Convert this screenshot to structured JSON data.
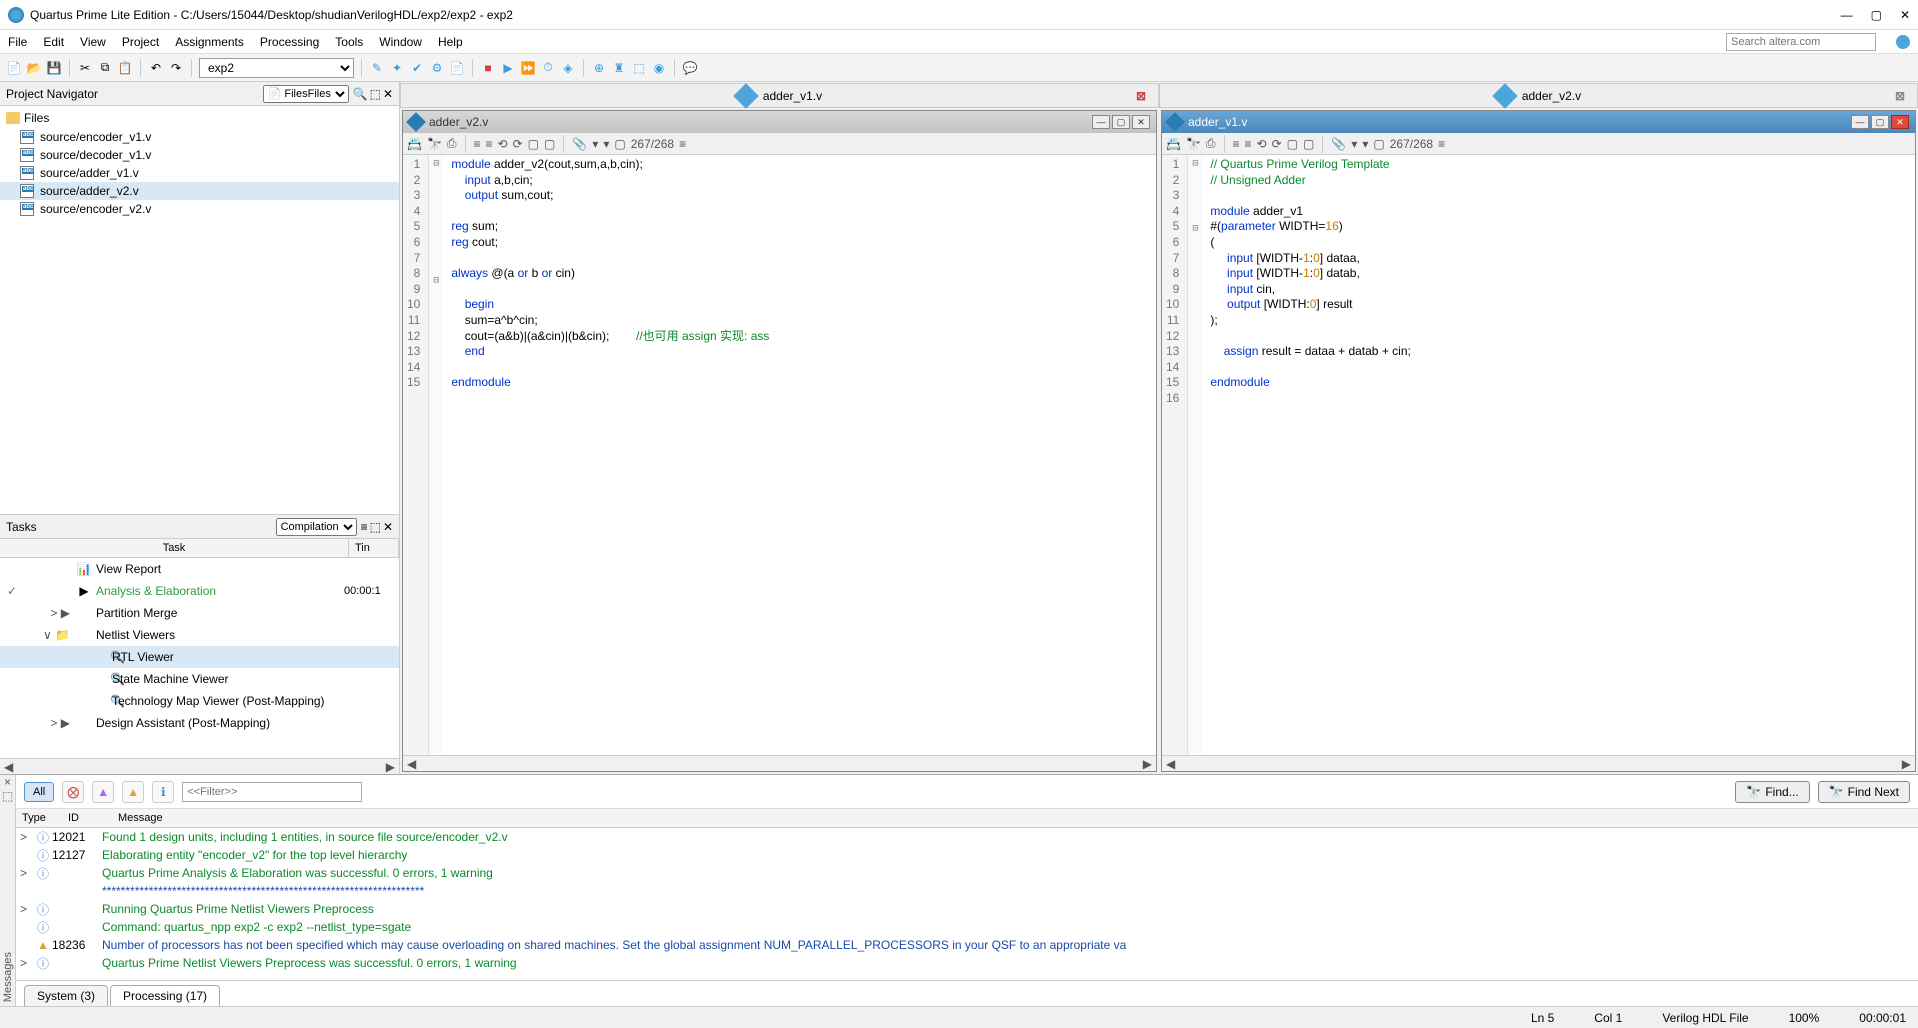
{
  "window": {
    "title": "Quartus Prime Lite Edition - C:/Users/15044/Desktop/shudianVerilogHDL/exp2/exp2 - exp2",
    "search_placeholder": "Search altera.com"
  },
  "menu": [
    "File",
    "Edit",
    "View",
    "Project",
    "Assignments",
    "Processing",
    "Tools",
    "Window",
    "Help"
  ],
  "toolbar_project": "exp2",
  "navigator": {
    "title": "Project Navigator",
    "filter": "Files",
    "root": "Files",
    "files": [
      "source/encoder_v1.v",
      "source/decoder_v1.v",
      "source/adder_v1.v",
      "source/adder_v2.v",
      "source/encoder_v2.v"
    ],
    "selected_index": 3
  },
  "tasks": {
    "title": "Tasks",
    "filter": "Compilation",
    "columns": [
      "Task",
      "Tin"
    ],
    "rows": [
      {
        "tree": "",
        "icon": "📊",
        "label": "View Report",
        "time": "",
        "status": ""
      },
      {
        "tree": "",
        "icon": "▶",
        "label": "Analysis & Elaboration",
        "time": "00:00:1",
        "status": "✓",
        "green": true
      },
      {
        "tree": "> ▶",
        "icon": "",
        "label": "Partition Merge",
        "time": "",
        "status": ""
      },
      {
        "tree": "∨ 📁",
        "icon": "",
        "label": "Netlist Viewers",
        "time": "",
        "status": ""
      },
      {
        "tree": "",
        "icon": "🔍",
        "label": "RTL Viewer",
        "time": "",
        "status": "",
        "selected": true,
        "indent": 2
      },
      {
        "tree": "",
        "icon": "🔍",
        "label": "State Machine Viewer",
        "time": "",
        "status": "",
        "indent": 2
      },
      {
        "tree": "",
        "icon": "🔍",
        "label": "Technology Map Viewer (Post-Mapping)",
        "time": "",
        "status": "",
        "indent": 2
      },
      {
        "tree": "> ▶",
        "icon": "",
        "label": "Design Assistant (Post-Mapping)",
        "time": "",
        "status": ""
      }
    ]
  },
  "tabs": [
    {
      "label": "adder_v1.v",
      "close_color": "red"
    },
    {
      "label": "adder_v2.v",
      "close_color": "gray"
    }
  ],
  "editor_left": {
    "title": "adder_v2.v",
    "active": false,
    "lines": [
      {
        "n": 1,
        "html": "<span class='kw'>module</span> adder_v2(cout,sum,a,b,cin);"
      },
      {
        "n": 2,
        "html": "    <span class='kw'>input</span> a,b,cin;"
      },
      {
        "n": 3,
        "html": "    <span class='kw'>output</span> sum,cout;"
      },
      {
        "n": 4,
        "html": ""
      },
      {
        "n": 5,
        "html": "<span class='kw'>reg</span> sum;"
      },
      {
        "n": 6,
        "html": "<span class='kw'>reg</span> cout;"
      },
      {
        "n": 7,
        "html": ""
      },
      {
        "n": 8,
        "html": "<span class='kw'>always</span> @(a <span class='kw'>or</span> b <span class='kw'>or</span> cin)"
      },
      {
        "n": 9,
        "html": ""
      },
      {
        "n": 10,
        "html": "    <span class='kw'>begin</span>"
      },
      {
        "n": 11,
        "html": "    sum=a^b^cin;"
      },
      {
        "n": 12,
        "html": "    cout=(a&b)|(a&cin)|(b&cin);        <span class='cm'>//也可用 assign 实现: ass</span>"
      },
      {
        "n": 13,
        "html": "    <span class='kw'>end</span>"
      },
      {
        "n": 14,
        "html": ""
      },
      {
        "n": 15,
        "html": "<span class='kw'>endmodule</span>"
      }
    ]
  },
  "editor_right": {
    "title": "adder_v1.v",
    "active": true,
    "lines": [
      {
        "n": 1,
        "html": "<span class='cm'>// Quartus Prime Verilog Template</span>"
      },
      {
        "n": 2,
        "html": "<span class='cm'>// Unsigned Adder</span>"
      },
      {
        "n": 3,
        "html": ""
      },
      {
        "n": 4,
        "html": "<span class='kw'>module</span> adder_v1"
      },
      {
        "n": 5,
        "html": "#(<span class='kw'>parameter</span> WIDTH=<span class='num'>16</span>)"
      },
      {
        "n": 6,
        "html": "("
      },
      {
        "n": 7,
        "html": "     <span class='kw'>input</span> [WIDTH-<span class='num'>1</span>:<span class='num'>0</span>] dataa,"
      },
      {
        "n": 8,
        "html": "     <span class='kw'>input</span> [WIDTH-<span class='num'>1</span>:<span class='num'>0</span>] datab,"
      },
      {
        "n": 9,
        "html": "     <span class='kw'>input</span> cin,"
      },
      {
        "n": 10,
        "html": "     <span class='kw'>output</span> [WIDTH:<span class='num'>0</span>] result"
      },
      {
        "n": 11,
        "html": ");"
      },
      {
        "n": 12,
        "html": ""
      },
      {
        "n": 13,
        "html": "    <span class='kw'>assign</span> result = dataa + datab + cin;"
      },
      {
        "n": 14,
        "html": ""
      },
      {
        "n": 15,
        "html": "<span class='kw'>endmodule</span>"
      },
      {
        "n": 16,
        "html": ""
      }
    ]
  },
  "messages": {
    "toolbar": {
      "all_label": "All",
      "filter_placeholder": "<<Filter>>",
      "find_label": "Find...",
      "find_next_label": "Find Next"
    },
    "head": [
      "Type",
      "ID",
      "Message"
    ],
    "rows": [
      {
        "toggle": ">",
        "sev": "info",
        "id": "12021",
        "text": "Found 1 design units, including 1 entities, in source file source/encoder_v2.v",
        "cls": "green"
      },
      {
        "toggle": "",
        "sev": "info",
        "id": "12127",
        "text": "Elaborating entity \"encoder_v2\" for the top level hierarchy",
        "cls": "green"
      },
      {
        "toggle": ">",
        "sev": "info",
        "id": "",
        "text": "Quartus Prime Analysis & Elaboration was successful. 0 errors, 1 warning",
        "cls": "green"
      },
      {
        "toggle": "",
        "sev": "",
        "id": "",
        "text": "*********************************************************************",
        "cls": "blue"
      },
      {
        "toggle": ">",
        "sev": "info",
        "id": "",
        "text": "Running Quartus Prime Netlist Viewers Preprocess",
        "cls": "green"
      },
      {
        "toggle": "",
        "sev": "info",
        "id": "",
        "text": "Command: quartus_npp exp2 -c exp2 --netlist_type=sgate",
        "cls": "green"
      },
      {
        "toggle": "",
        "sev": "warn",
        "id": "18236",
        "text": "Number of processors has not been specified which may cause overloading on shared machines.  Set the global assignment NUM_PARALLEL_PROCESSORS in your QSF to an appropriate va",
        "cls": "blue"
      },
      {
        "toggle": ">",
        "sev": "info",
        "id": "",
        "text": "Quartus Prime Netlist Viewers Preprocess was successful. 0 errors, 1 warning",
        "cls": "green"
      }
    ],
    "tabs": [
      {
        "label": "System (3)",
        "active": false
      },
      {
        "label": "Processing (17)",
        "active": true
      }
    ]
  },
  "statusbar": {
    "pos": "Ln 5",
    "col": "Col 1",
    "mode": "Verilog HDL File",
    "zoom": "100%",
    "time": "00:00:01"
  }
}
